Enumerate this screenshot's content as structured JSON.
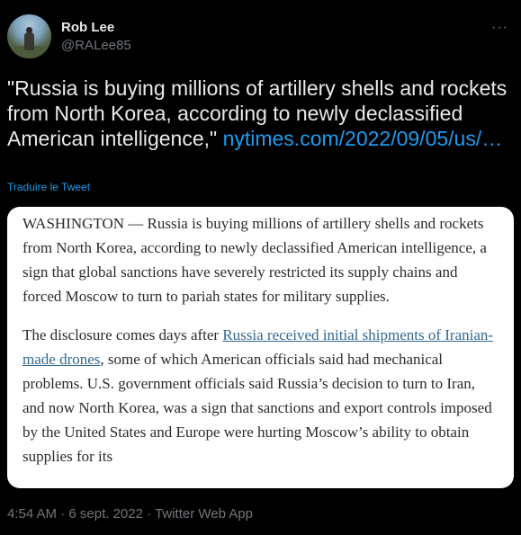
{
  "author": {
    "name": "Rob Lee",
    "handle": "@RALee85"
  },
  "more_glyph": "···",
  "tweet": {
    "text": "\"Russia is buying millions of artillery shells and rockets from North Korea, according to newly declassified American intelligence,\"",
    "link": "nytimes.com/2022/09/05/us/…",
    "translate_label": "Traduire le Tweet"
  },
  "article": {
    "para1": "WASHINGTON — Russia is buying millions of artillery shells and rockets from North Korea, according to newly declassified American intelligence, a sign that global sanctions have severely restricted its supply chains and forced Moscow to turn to pariah states for military supplies.",
    "para2_before": "The disclosure comes days after ",
    "para2_link": "Russia received initial shipments of Iranian-made drones",
    "para2_after": ", some of which American officials said had mechanical problems. U.S. government officials said Russia’s decision to turn to Iran, and now North Korea, was a sign that sanctions and export controls imposed by the United States and Europe were hurting Moscow’s ability to obtain supplies for its"
  },
  "meta": {
    "time": "4:54 AM",
    "separator1": " · ",
    "date": "6 sept. 2022",
    "separator2": " · ",
    "source": "Twitter Web App"
  }
}
